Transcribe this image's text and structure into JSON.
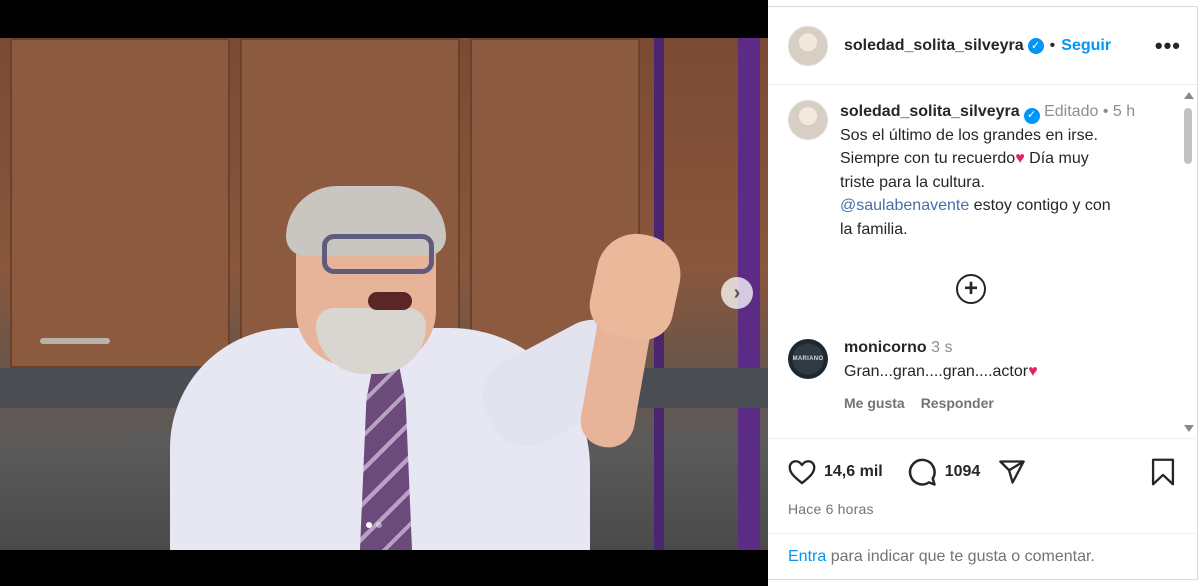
{
  "post": {
    "author": "soledad_solita_silveyra",
    "follow_label": "Seguir",
    "separator": "•",
    "more_label": "•••",
    "next_label": "›"
  },
  "caption": {
    "author": "soledad_solita_silveyra",
    "edited_label": "Editado",
    "separator": "•",
    "age": "5 h",
    "line1": "Sos el último de los grandes en irse.",
    "line2a": "Siempre con tu recuerdo",
    "line2b": "  Día muy",
    "line3": "triste para la cultura.",
    "mention": "@saulabenavente",
    "line4": " estoy contigo y con",
    "line5": "la familia."
  },
  "load_more_label": "+",
  "comment": {
    "author": "monicorno",
    "age": "3 s",
    "text": "Gran...gran....gran....actor",
    "avatar_text": "MARIANO",
    "like_label": "Me gusta",
    "reply_label": "Responder"
  },
  "stats": {
    "likes": "14,6 mil",
    "comments": "1094"
  },
  "time_ago": "Hace 6 horas",
  "login": {
    "link": "Entra",
    "text": " para indicar que te gusta o comentar."
  },
  "icons": {
    "heart": "heart-icon",
    "comment": "comment-icon",
    "share": "share-icon",
    "save": "bookmark-icon",
    "verified": "verified-badge-icon"
  },
  "colors": {
    "accent": "#0095f6",
    "text": "#262626",
    "muted": "#737373",
    "heart": "#e0245e"
  },
  "carousel": {
    "slides": 2,
    "active": 1
  }
}
